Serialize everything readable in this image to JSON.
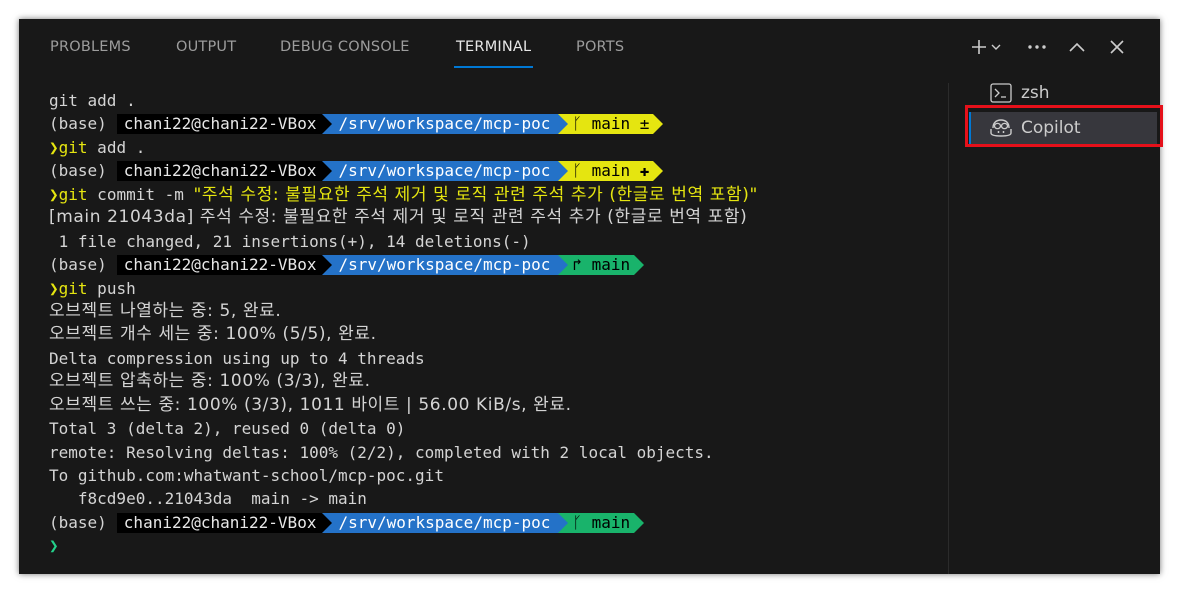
{
  "tabs": [
    {
      "label": "PROBLEMS"
    },
    {
      "label": "OUTPUT"
    },
    {
      "label": "DEBUG CONSOLE"
    },
    {
      "label": "TERMINAL",
      "active": true
    },
    {
      "label": "PORTS"
    }
  ],
  "prompt": {
    "base": "(base)",
    "user": "chani22@chani22-VBox",
    "path": "/srv/workspace/mcp-poc",
    "branch": "main",
    "chevron": "❯"
  },
  "terminal": {
    "l1": "git add .",
    "p1_git": "ᚴ main ±",
    "c2_cmd": "git",
    "c2_arg": " add .",
    "p2_git": "ᚴ main ✚",
    "c3_cmd": "git",
    "c3_arg": " commit -m ",
    "c3_str": "\"주석 수정: 불필요한 주석 제거 및 로직 관련 주석 추가 (한글로 번역 포함)\"",
    "o1": "[main 21043da] 주석 수정: 불필요한 주석 제거 및 로직 관련 주석 추가 (한글로 번역 포함)",
    "o2": " 1 file changed, 21 insertions(+), 14 deletions(-)",
    "p3_git": "↱ main",
    "c4_cmd": "git",
    "c4_arg": " push",
    "o3": "오브젝트 나열하는 중: 5, 완료.",
    "o4": "오브젝트 개수 세는 중: 100% (5/5), 완료.",
    "o5": "Delta compression using up to 4 threads",
    "o6": "오브젝트 압축하는 중: 100% (3/3), 완료.",
    "o7": "오브젝트 쓰는 중: 100% (3/3), 1011 바이트 | 56.00 KiB/s, 완료.",
    "o8": "Total 3 (delta 2), reused 0 (delta 0)",
    "o9": "remote: Resolving deltas: 100% (2/2), completed with 2 local objects.",
    "o10": "To github.com:whatwant-school/mcp-poc.git",
    "o11": "   f8cd9e0..21043da  main -> main",
    "p4_git": "ᚴ main"
  },
  "sidebar": {
    "items": [
      {
        "label": "zsh",
        "icon": "terminal-icon"
      },
      {
        "label": "Copilot",
        "icon": "copilot-icon",
        "selected": true
      }
    ]
  },
  "colors": {
    "panel": "#181818",
    "accent": "#0078d4",
    "path": "#2472c8",
    "git_dirty": "#e5e510",
    "git_clean": "#19b36b",
    "highlight": "#e5101a"
  }
}
